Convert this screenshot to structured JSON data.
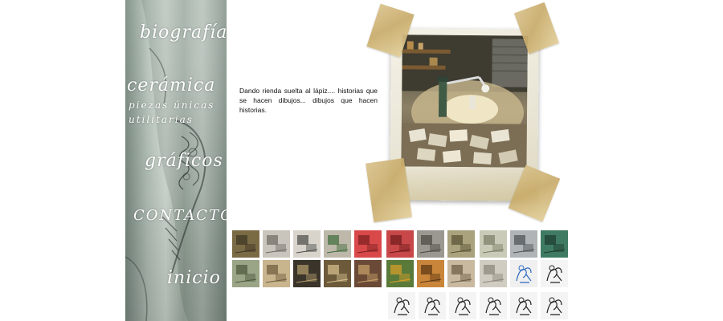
{
  "nav": {
    "biografia": "biografía",
    "ceramica": "cerámica",
    "piezas_unicas": "piezas únicas",
    "utilitarias": "utilitarias",
    "graficos": "gráficos",
    "contacto": "CONTACTO",
    "inicio": "inicio"
  },
  "intro": {
    "text": "Dando rienda suelta al lápiz.... historias que se hacen dibujos... dibujos que hacen historias."
  },
  "colors": {
    "tape": "#d9c28c",
    "polaroid": "#f1eee2",
    "sidebar": "#b9c7bd"
  },
  "thumbnails": [
    {
      "color": "#7a6b45",
      "accent": "#3d3424",
      "icon": "photo-thumb"
    },
    {
      "color": "#c9c5bd",
      "accent": "#6d6a63",
      "icon": "photo-thumb"
    },
    {
      "color": "#d8d4cc",
      "accent": "#4a4a44",
      "icon": "photo-thumb"
    },
    {
      "color": "#bdb8a9",
      "accent": "#3f6b3a",
      "icon": "photo-thumb"
    },
    {
      "color": "#d9494a",
      "accent": "#7b1f20",
      "icon": "photo-thumb"
    },
    {
      "color": "#c8484a",
      "accent": "#6e1a1b",
      "icon": "photo-thumb"
    },
    {
      "color": "#9a9890",
      "accent": "#4a4741",
      "icon": "photo-thumb"
    },
    {
      "color": "#a9a27d",
      "accent": "#555032",
      "icon": "photo-thumb"
    },
    {
      "color": "#c9cab7",
      "accent": "#7a7c63",
      "icon": "photo-thumb"
    },
    {
      "color": "#b0b4b6",
      "accent": "#4a4f54",
      "icon": "photo-thumb"
    },
    {
      "color": "#3f7a62",
      "accent": "#1c3a2d",
      "icon": "photo-thumb"
    },
    {
      "color": "#9aa486",
      "accent": "#4b553c",
      "icon": "photo-thumb"
    },
    {
      "color": "#c8b48d",
      "accent": "#6b5a3c",
      "icon": "photo-thumb"
    },
    {
      "color": "#3a342a",
      "accent": "#b49e6c",
      "icon": "photo-thumb"
    },
    {
      "color": "#6c5a3a",
      "accent": "#d8c090",
      "icon": "photo-thumb"
    },
    {
      "color": "#6a4a36",
      "accent": "#c8a16a",
      "icon": "photo-thumb"
    },
    {
      "color": "#5a7a3a",
      "accent": "#d9a02a",
      "icon": "photo-thumb"
    },
    {
      "color": "#c9863a",
      "accent": "#5a3412",
      "icon": "photo-thumb"
    },
    {
      "color": "#c9b9a1",
      "accent": "#6b5a42",
      "icon": "photo-thumb"
    },
    {
      "color": "#d0ccc2",
      "accent": "#8a8478",
      "icon": "photo-thumb"
    },
    {
      "color": "#f0f0f0",
      "accent": "#2a6ac0",
      "icon": "drawing-thumb"
    },
    {
      "color": "#f4f4f4",
      "accent": "#222222",
      "icon": "drawing-thumb"
    },
    {
      "color": "#f4f4f4",
      "accent": "#222222",
      "icon": "drawing-thumb"
    },
    {
      "color": "#f4f4f4",
      "accent": "#222222",
      "icon": "drawing-thumb"
    },
    {
      "color": "#f4f4f4",
      "accent": "#222222",
      "icon": "drawing-thumb"
    },
    {
      "color": "#f4f4f4",
      "accent": "#222222",
      "icon": "drawing-thumb"
    },
    {
      "color": "#f4f4f4",
      "accent": "#222222",
      "icon": "drawing-thumb"
    },
    {
      "color": "#f4f4f4",
      "accent": "#222222",
      "icon": "drawing-thumb"
    }
  ]
}
